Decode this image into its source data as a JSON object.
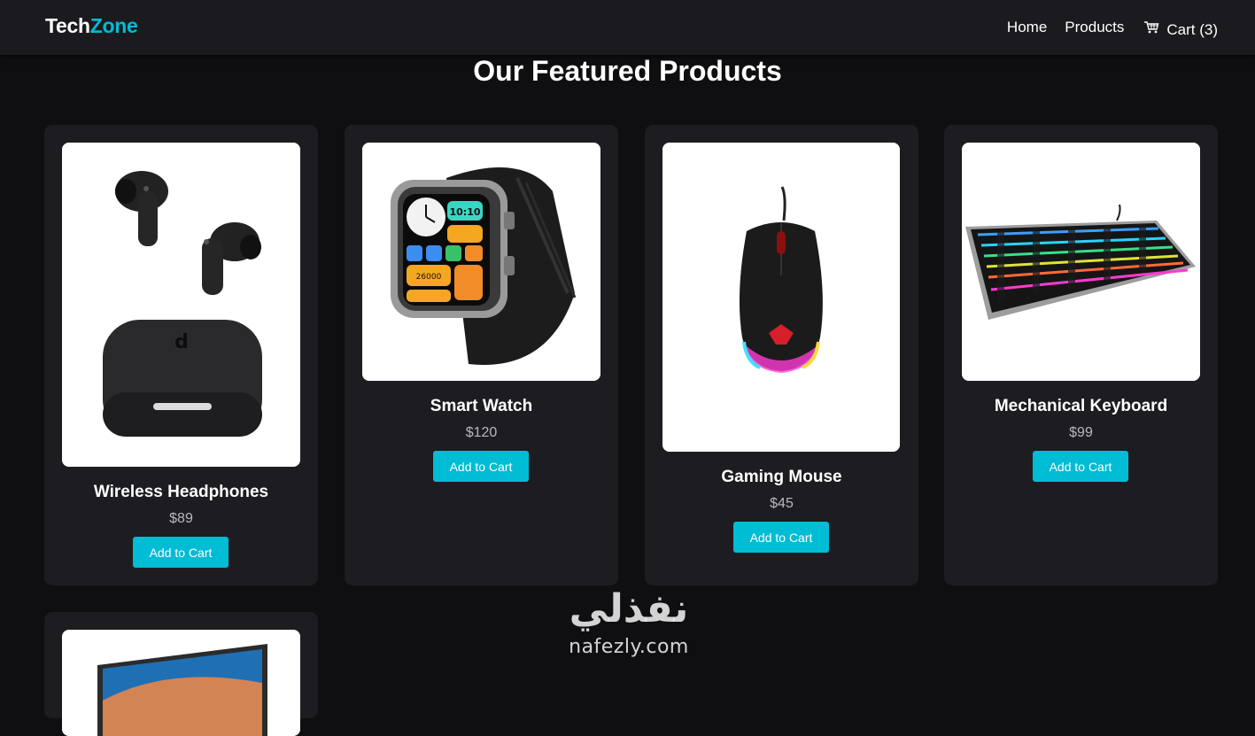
{
  "header": {
    "logo_part1": "Tech",
    "logo_part2": "Zone",
    "nav": {
      "home": "Home",
      "products": "Products",
      "cart": "Cart (3)"
    }
  },
  "main": {
    "title": "Our Featured Products",
    "products": [
      {
        "name": "Wireless Headphones",
        "price": "$89",
        "button": "Add to Cart",
        "image_icon": "earbuds-image"
      },
      {
        "name": "Smart Watch",
        "price": "$120",
        "button": "Add to Cart",
        "image_icon": "smartwatch-image"
      },
      {
        "name": "Gaming Mouse",
        "price": "$45",
        "button": "Add to Cart",
        "image_icon": "gaming-mouse-image"
      },
      {
        "name": "Mechanical Keyboard",
        "price": "$99",
        "button": "Add to Cart",
        "image_icon": "keyboard-image"
      },
      {
        "name": "",
        "price": "",
        "button": "",
        "image_icon": "monitor-image"
      }
    ]
  },
  "watermark": {
    "arabic": "نفذلي",
    "latin": "nafezly.com"
  },
  "colors": {
    "accent": "#00bcd4",
    "background": "#0f0f11",
    "card": "#1c1c21",
    "navbar": "#1b1b1f"
  }
}
